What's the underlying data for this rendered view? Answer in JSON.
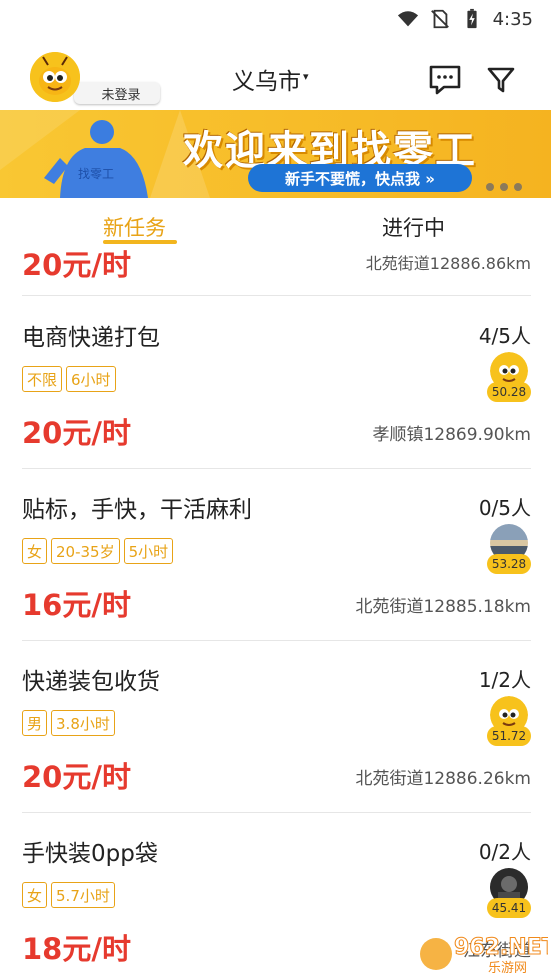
{
  "status_bar": {
    "time": "4:35"
  },
  "header": {
    "login_label": "未登录",
    "city": "义乌市",
    "city_caret": "▾"
  },
  "banner": {
    "title": "欢迎来到找零工",
    "button_label": "新手不要慌，快点我 »",
    "shirt_text": "找零工",
    "dot_count": 3
  },
  "tabs": [
    {
      "label": "新任务",
      "active": true
    },
    {
      "label": "进行中",
      "active": false
    }
  ],
  "partial_item": {
    "price": "20元/时",
    "distance": "北苑街道12886.86km"
  },
  "jobs": [
    {
      "title": "电商快递打包",
      "count": "4/5人",
      "tags": [
        "不限",
        "6小时"
      ],
      "price": "20元/时",
      "distance": "孝顺镇12869.90km",
      "score": "50.28",
      "avatar": "ant"
    },
    {
      "title": "贴标，手快，干活麻利",
      "count": "0/5人",
      "tags": [
        "女",
        "20-35岁",
        "5小时"
      ],
      "price": "16元/时",
      "distance": "北苑街道12885.18km",
      "score": "53.28",
      "avatar": "sunset"
    },
    {
      "title": "快递装包收货",
      "count": "1/2人",
      "tags": [
        "男",
        "3.8小时"
      ],
      "price": "20元/时",
      "distance": "北苑街道12886.26km",
      "score": "51.72",
      "avatar": "ant"
    },
    {
      "title": "手快装0pp袋",
      "count": "0/2人",
      "tags": [
        "女",
        "5.7小时"
      ],
      "price": "18元/时",
      "distance": "江东街道",
      "score": "45.41",
      "avatar": "dark"
    }
  ],
  "watermark": {
    "text": "962.NET",
    "sub": "乐游网"
  },
  "colors": {
    "accent": "#e8a317",
    "price": "#e63a2e",
    "banner": "#f9c733",
    "banner_button": "#1e74d6"
  }
}
